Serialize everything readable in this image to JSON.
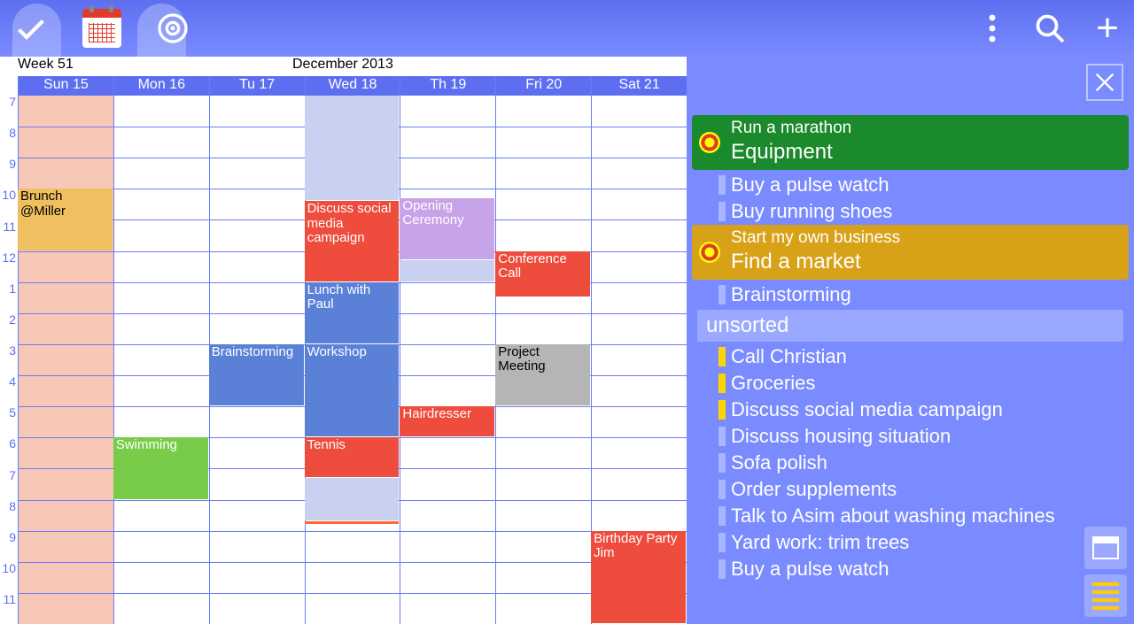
{
  "header": {
    "week": "Week 51",
    "month": "December   2013"
  },
  "days": [
    "Sun 15",
    "Mon 16",
    "Tu 17",
    "Wed 18",
    "Th 19",
    "Fri 20",
    "Sat 21"
  ],
  "hours": [
    "7",
    "8",
    "9",
    "10",
    "11",
    "12",
    "1",
    "2",
    "3",
    "4",
    "5",
    "6",
    "7",
    "8",
    "9",
    "10",
    "11"
  ],
  "events": {
    "brunch": "Brunch @Miller",
    "swimming": "Swimming",
    "brainstorming": "Brainstorming",
    "discuss": "Discuss social media campaign",
    "lunch": "Lunch with Paul",
    "workshop": "Workshop",
    "tennis": "Tennis",
    "opening": "Opening Ceremony",
    "hairdresser": "Hairdresser",
    "conference": "Conference Call",
    "project": "Project Meeting",
    "birthday": "Birthday Party Jim"
  },
  "goals": [
    {
      "subtitle": "Run a marathon",
      "title": "Equipment",
      "color": "#1a8a2c"
    },
    {
      "subtitle": "Start my own business",
      "title": "Find a market",
      "color": "#d8a218"
    }
  ],
  "goal1_tasks": [
    "Buy a pulse watch",
    "Buy running shoes"
  ],
  "goal2_tasks": [
    "Brainstorming"
  ],
  "unsorted_label": "unsorted",
  "unsorted": [
    {
      "t": "Call Christian",
      "c": "#ffd500"
    },
    {
      "t": "Groceries",
      "c": "#ffd500"
    },
    {
      "t": "Discuss social media campaign",
      "c": "#ffd500"
    },
    {
      "t": "Discuss housing situation",
      "c": ""
    },
    {
      "t": "Sofa polish",
      "c": ""
    },
    {
      "t": "Order supplements",
      "c": ""
    },
    {
      "t": "Talk to Asim about washing machines",
      "c": ""
    },
    {
      "t": "Yard work: trim trees",
      "c": ""
    },
    {
      "t": "Buy a pulse watch",
      "c": ""
    }
  ]
}
